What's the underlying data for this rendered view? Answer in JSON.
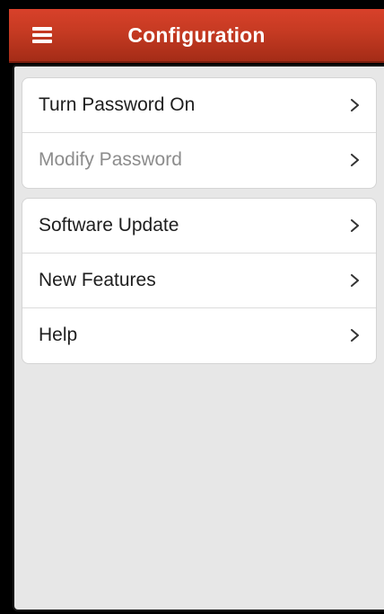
{
  "header": {
    "title": "Configuration",
    "menu_icon": "hamburger-menu-icon",
    "background_color": "#c53a22"
  },
  "groups": [
    {
      "items": [
        {
          "label": "Turn Password On",
          "enabled": true,
          "icon": "chevron-right-icon"
        },
        {
          "label": "Modify Password",
          "enabled": false,
          "icon": "chevron-right-icon"
        }
      ]
    },
    {
      "items": [
        {
          "label": "Software Update",
          "enabled": true,
          "icon": "chevron-right-icon"
        },
        {
          "label": "New Features",
          "enabled": true,
          "icon": "chevron-right-icon"
        },
        {
          "label": "Help",
          "enabled": true,
          "icon": "chevron-right-icon"
        }
      ]
    }
  ],
  "colors": {
    "content_background": "#e7e7e7",
    "text": "#1e1e1e",
    "disabled_text": "#8c8c8c"
  }
}
